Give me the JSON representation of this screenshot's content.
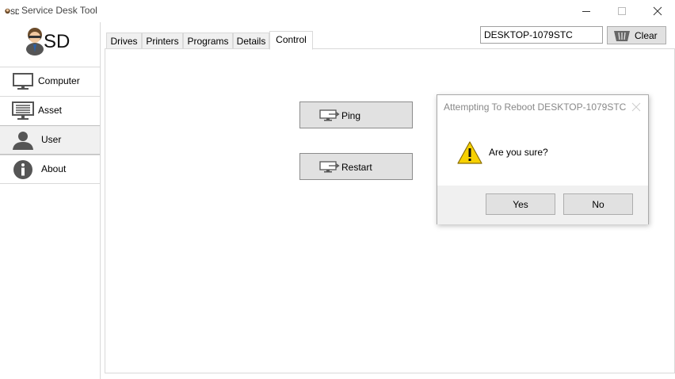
{
  "window": {
    "title": "Service Desk Tool",
    "app_icon_text": "SD"
  },
  "sidebar": {
    "logo_text": "SD",
    "items": [
      {
        "label": "Computer",
        "icon": "monitor-icon"
      },
      {
        "label": "Asset",
        "icon": "asset-list-icon"
      },
      {
        "label": "User",
        "icon": "user-icon"
      },
      {
        "label": "About",
        "icon": "info-icon"
      }
    ],
    "selected": "User"
  },
  "toolbar": {
    "search_value": "DESKTOP-1079STC",
    "clear_label": "Clear"
  },
  "tabs": [
    {
      "label": "Drives"
    },
    {
      "label": "Printers"
    },
    {
      "label": "Programs"
    },
    {
      "label": "Details"
    },
    {
      "label": "Control"
    }
  ],
  "active_tab": "Control",
  "control": {
    "ping_label": "Ping",
    "restart_label": "Restart"
  },
  "dialog": {
    "title": "Attempting To Reboot DESKTOP-1079STC",
    "message": "Are you sure?",
    "yes_label": "Yes",
    "no_label": "No"
  },
  "colors": {
    "button_bg": "#e1e1e1",
    "selected_bg": "#f0f0f0",
    "warning_yellow": "#f7d100"
  }
}
